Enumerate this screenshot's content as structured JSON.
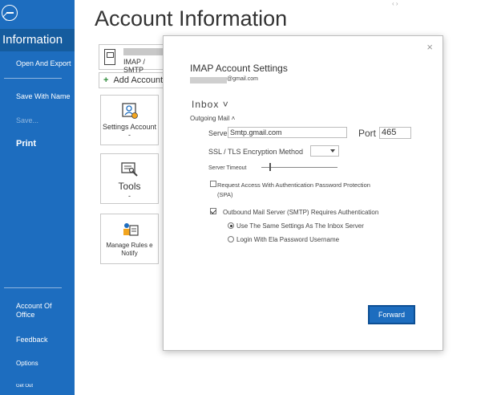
{
  "sidebar": {
    "active_label": "Information",
    "open_export": "Open And Export",
    "save_name": "Save With Name",
    "save_disabled": "Save...",
    "print": "Print",
    "office_account": "Account Of Office",
    "feedback": "Feedback",
    "options": "Options",
    "exit": "Get Out"
  },
  "main": {
    "title": "Account Information",
    "account_type": "IMAP / SMTP",
    "add_account": "Add Account",
    "tiles": {
      "settings": "Settings Account -",
      "tools": "Tools",
      "tools_caret": "-",
      "manage_rules": "Manage Rules e Notify"
    }
  },
  "dialog": {
    "close": "×",
    "title": "IMAP Account Settings",
    "email_suffix": "@gmail.com",
    "inbox_label": "Inbox",
    "inbox_caret": "˅",
    "outgoing_label": "Outgoing Mail",
    "outgoing_caret": "˄",
    "server_label": "Server",
    "server_value": "Smtp.gmail.com",
    "port_label": "Port",
    "port_value": "465",
    "ssl_label": "SSL / TLS Encryption Method",
    "timeout_label": "Server Timeout",
    "spa_label": "Request Access With Authentication Password Protection",
    "spa_label2": "(SPA)",
    "smtp_auth_label": "Outbound Mail Server (SMTP) Requires Authentication",
    "same_settings_label": "Use The Same Settings As The Inbox Server",
    "login_label": "Login With Ela Password Username",
    "forward_button": "Forward",
    "spa_checked": false,
    "smtp_auth_checked": true,
    "same_settings_selected": true
  },
  "colors": {
    "sidebar_blue": "#1d6dbf",
    "sidebar_active": "#155c9e",
    "button_blue": "#1d6dbf"
  }
}
